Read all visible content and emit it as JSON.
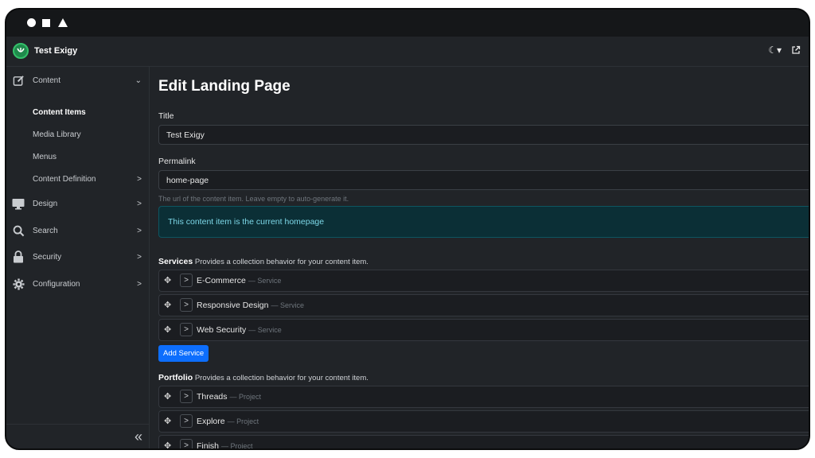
{
  "app": {
    "site_name": "Test Exigy"
  },
  "sidebar": {
    "items": [
      {
        "label": "Content"
      },
      {
        "label": "Design"
      },
      {
        "label": "Search"
      },
      {
        "label": "Security"
      },
      {
        "label": "Configuration"
      }
    ],
    "content_subitems": [
      {
        "label": "Content Items",
        "active": true
      },
      {
        "label": "Media Library"
      },
      {
        "label": "Menus"
      },
      {
        "label": "Content Definition"
      }
    ],
    "collapse_glyph": "«"
  },
  "header": {
    "theme_glyph": "☾▾"
  },
  "form": {
    "title": "Edit Landing Page",
    "title_label": "Title",
    "title_value": "Test Exigy",
    "permalink_label": "Permalink",
    "permalink_value": "home-page",
    "permalink_hint": "The url of the content item. Leave empty to auto-generate it.",
    "homepage_notice": "This content item is the current homepage"
  },
  "services": {
    "heading": "Services",
    "description": "Provides a collection behavior for your content item.",
    "items": [
      {
        "name": "E-Commerce",
        "type": "— Service"
      },
      {
        "name": "Responsive Design",
        "type": "— Service"
      },
      {
        "name": "Web Security",
        "type": "— Service"
      }
    ],
    "add_label": "Add Service"
  },
  "portfolio": {
    "heading": "Portfolio",
    "description": "Provides a collection behavior for your content item.",
    "items": [
      {
        "name": "Threads",
        "type": "— Project"
      },
      {
        "name": "Explore",
        "type": "— Project"
      },
      {
        "name": "Finish",
        "type": "— Project"
      }
    ]
  },
  "colors": {
    "accent": "#0d6efd",
    "background": "#212428",
    "alert_bg": "#0b2f36",
    "alert_text": "#7dd8e8",
    "logo": "#1f8a4c"
  },
  "icons": [
    "edit-icon",
    "monitor-icon",
    "search-icon",
    "lock-icon",
    "gear-icon",
    "move-icon",
    "chevron-right-icon",
    "external-link-icon",
    "moon-icon"
  ]
}
